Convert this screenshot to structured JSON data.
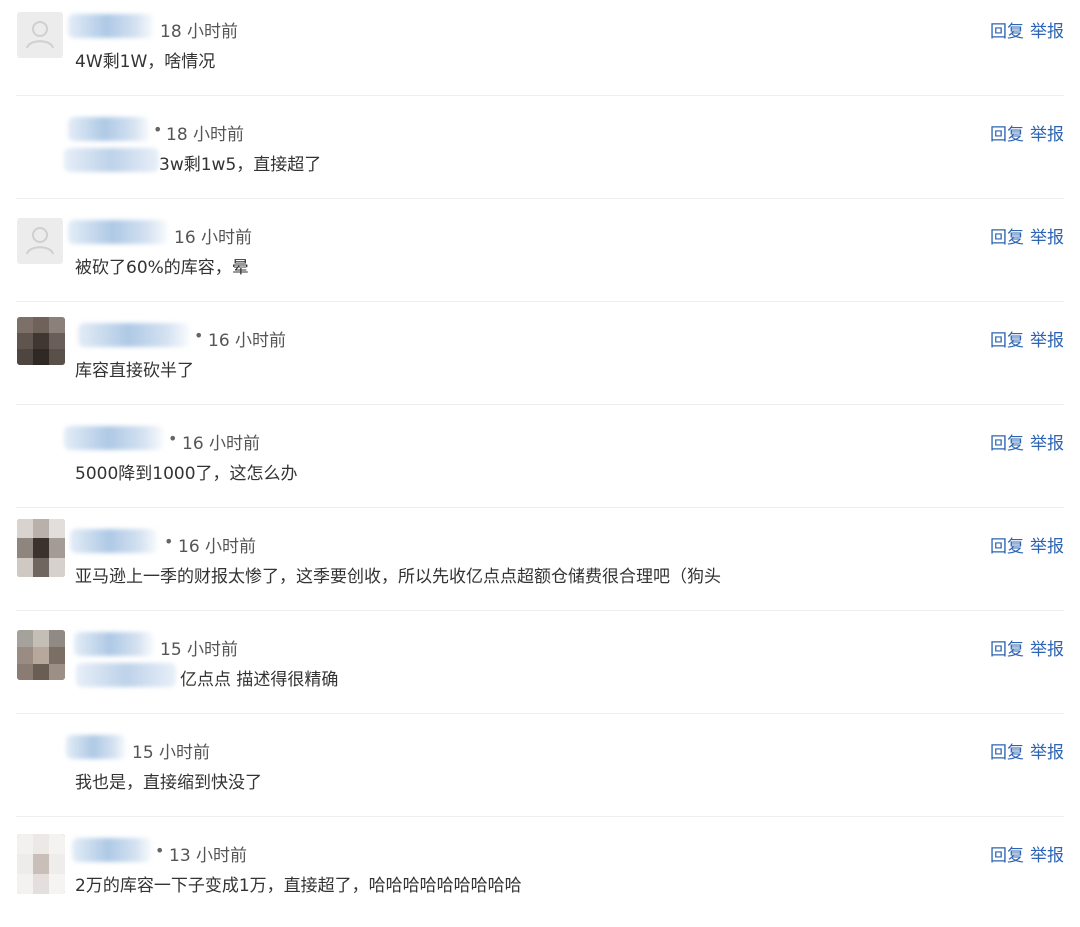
{
  "actions": {
    "reply_label": "回复",
    "report_label": "举报"
  },
  "comments": [
    {
      "time": "18 小时前",
      "text": "4W剩1W，啥情况",
      "avatar": "user-icon"
    },
    {
      "time": "18 小时前",
      "text": "3w剩1w5，直接超了",
      "avatar": "none"
    },
    {
      "time": "16 小时前",
      "text": "被砍了60%的库容，晕",
      "avatar": "user-icon"
    },
    {
      "time": "16 小时前",
      "text": "库容直接砍半了",
      "avatar": "photo"
    },
    {
      "time": "16 小时前",
      "text": "5000降到1000了，这怎么办",
      "avatar": "none"
    },
    {
      "time": "16 小时前",
      "text": "亚马逊上一季的财报太惨了，这季要创收，所以先收亿点点超额仓储费很合理吧（狗头",
      "avatar": "photo"
    },
    {
      "time": "15 小时前",
      "text": "亿点点 描述得很精确",
      "avatar": "photo"
    },
    {
      "time": "15 小时前",
      "text": "我也是，直接缩到快没了",
      "avatar": "none"
    },
    {
      "time": "13 小时前",
      "text": "2万的库容一下子变成1万，直接超了，哈哈哈哈哈哈哈哈哈",
      "avatar": "photo"
    }
  ],
  "colors": {
    "link": "#2d64b3",
    "text": "#333333",
    "meta": "#555555",
    "divider": "#eeeeee"
  }
}
